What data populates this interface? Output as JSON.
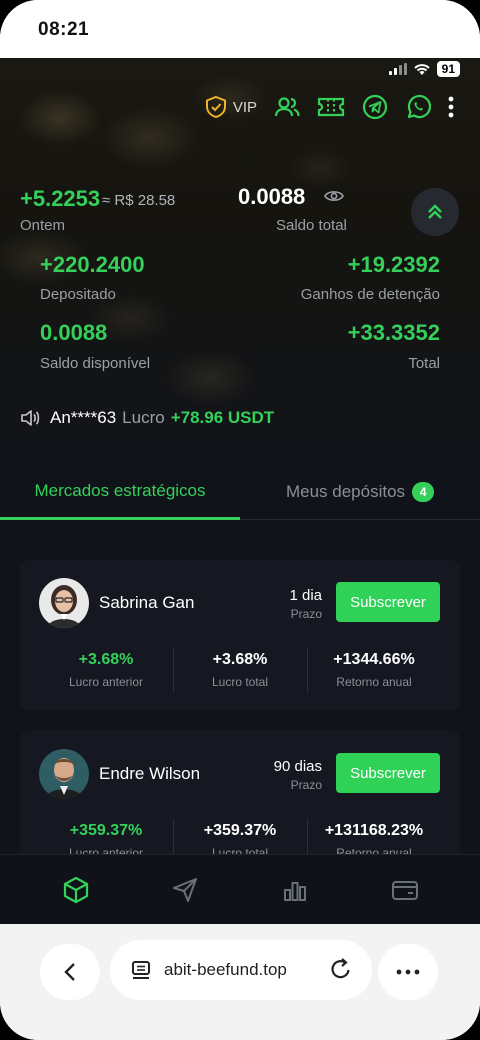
{
  "os": {
    "time": "08:21",
    "battery": "91"
  },
  "header": {
    "vip_label": "VIP"
  },
  "summary": {
    "yesterday_value": "+5.2253",
    "yesterday_brl": "≈ R$ 28.58",
    "yesterday_label": "Ontem",
    "total_balance_value": "0.0088",
    "total_balance_label": "Saldo total",
    "deposited_value": "+220.2400",
    "deposited_label": "Depositado",
    "holding_gains_value": "+19.2392",
    "holding_gains_label": "Ganhos de detenção",
    "available_value": "0.0088",
    "available_label": "Saldo disponível",
    "total_value": "+33.3352",
    "total_label": "Total"
  },
  "ticker": {
    "user": "An****63",
    "lucro_label": "Lucro",
    "amount": "+78.96 USDT"
  },
  "tabs": [
    {
      "label": "Mercados estratégicos",
      "active": true
    },
    {
      "label": "Meus depósitos",
      "badge": "4",
      "active": false
    }
  ],
  "cards": [
    {
      "name": "Sabrina Gan",
      "term": "1 dia",
      "term_label": "Prazo",
      "button": "Subscrever",
      "stats": [
        {
          "value": "+3.68%",
          "label": "Lucro anterior",
          "color": "#35d05a"
        },
        {
          "value": "+3.68%",
          "label": "Lucro total",
          "color": "#ffffff"
        },
        {
          "value": "+1344.66%",
          "label": "Retorno anual",
          "color": "#ffffff"
        }
      ]
    },
    {
      "name": "Endre Wilson",
      "term": "90 dias",
      "term_label": "Prazo",
      "button": "Subscrever",
      "stats": [
        {
          "value": "+359.37%",
          "label": "Lucro anterior",
          "color": "#35d05a"
        },
        {
          "value": "+359.37%",
          "label": "Lucro total",
          "color": "#ffffff"
        },
        {
          "value": "+131168.23%",
          "label": "Retorno anual",
          "color": "#ffffff"
        }
      ]
    }
  ],
  "bottom_nav": [
    "cube-icon",
    "send-icon",
    "bar-chart-icon",
    "wallet-icon"
  ],
  "browser": {
    "url": "abit-beefund.top"
  },
  "colors": {
    "accent": "#35d05a",
    "background": "#101319",
    "vip_gold": "#f0b429"
  }
}
